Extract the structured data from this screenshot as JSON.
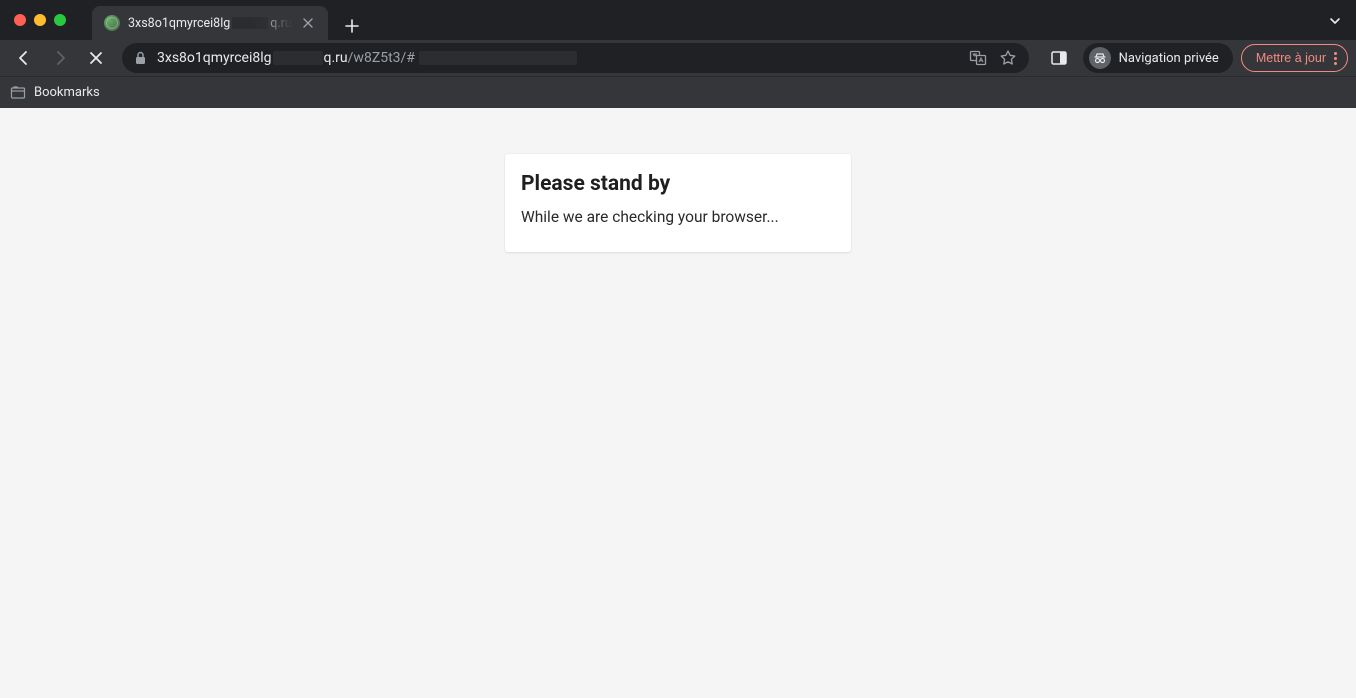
{
  "browser": {
    "tab": {
      "title_prefix": "3xs8o1qmyrcei8lg",
      "title_suffix": "q.ru"
    },
    "url": {
      "host_prefix": "3xs8o1qmyrcei8lg",
      "host_suffix": "q.ru",
      "path": "/w8Z5t3/#"
    },
    "incognito_label": "Navigation privée",
    "update_label": "Mettre à jour",
    "bookmarks_label": "Bookmarks"
  },
  "page": {
    "heading": "Please stand by",
    "subtext": "While we are checking your browser..."
  }
}
